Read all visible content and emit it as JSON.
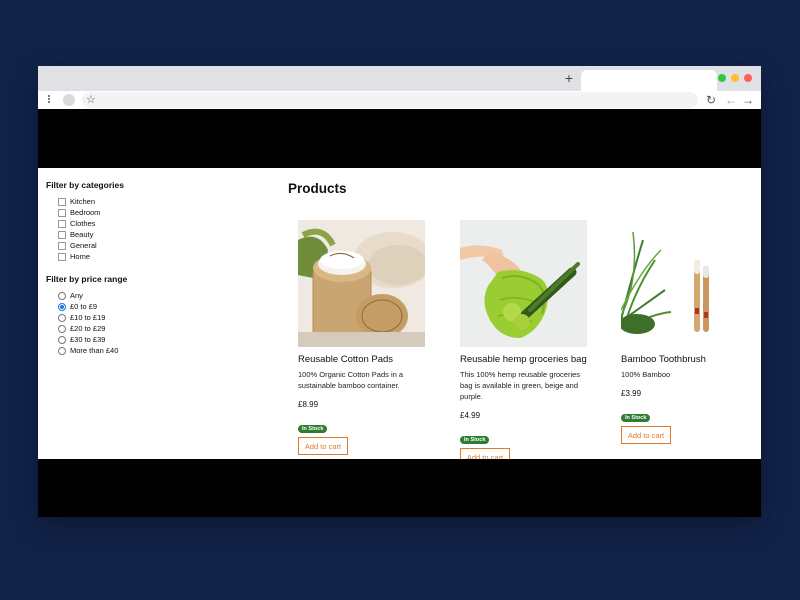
{
  "browser": {
    "new_tab_label": "+",
    "window_dot_colors": [
      "#2bc840",
      "#febc2e",
      "#ff5f57"
    ]
  },
  "sidebar": {
    "category_title": "Filter by categories",
    "categories": [
      "Kitchen",
      "Bedroom",
      "Clothes",
      "Beauty",
      "General",
      "Home"
    ],
    "price_title": "Filter by price range",
    "price_ranges": [
      "Any",
      "£0 to £9",
      "£10 to £19",
      "£20 to £29",
      "£30 to £39",
      "More than £40"
    ],
    "selected_price_range": "£0 to £9"
  },
  "main": {
    "title": "Products",
    "products": [
      {
        "name": "Reusable Cotton Pads",
        "description": "100% Organic Cotton Pads in a sustainable bamboo container.",
        "price": "£8.99",
        "stock": "In Stock",
        "button": "Add to cart"
      },
      {
        "name": "Reusable hemp groceries bag",
        "description": "This 100% hemp reusable groceries bag is available in green, beige and purple.",
        "price": "£4.99",
        "stock": "In Stock",
        "button": "Add to cart"
      },
      {
        "name": "Bamboo Toothbrush",
        "description": "100% Bamboo",
        "price": "£3.99",
        "stock": "In Stock",
        "button": "Add to cart"
      }
    ]
  },
  "colors": {
    "background": "#12234a",
    "accent": "#e07a2a",
    "stock_badge": "#2e7d32"
  }
}
